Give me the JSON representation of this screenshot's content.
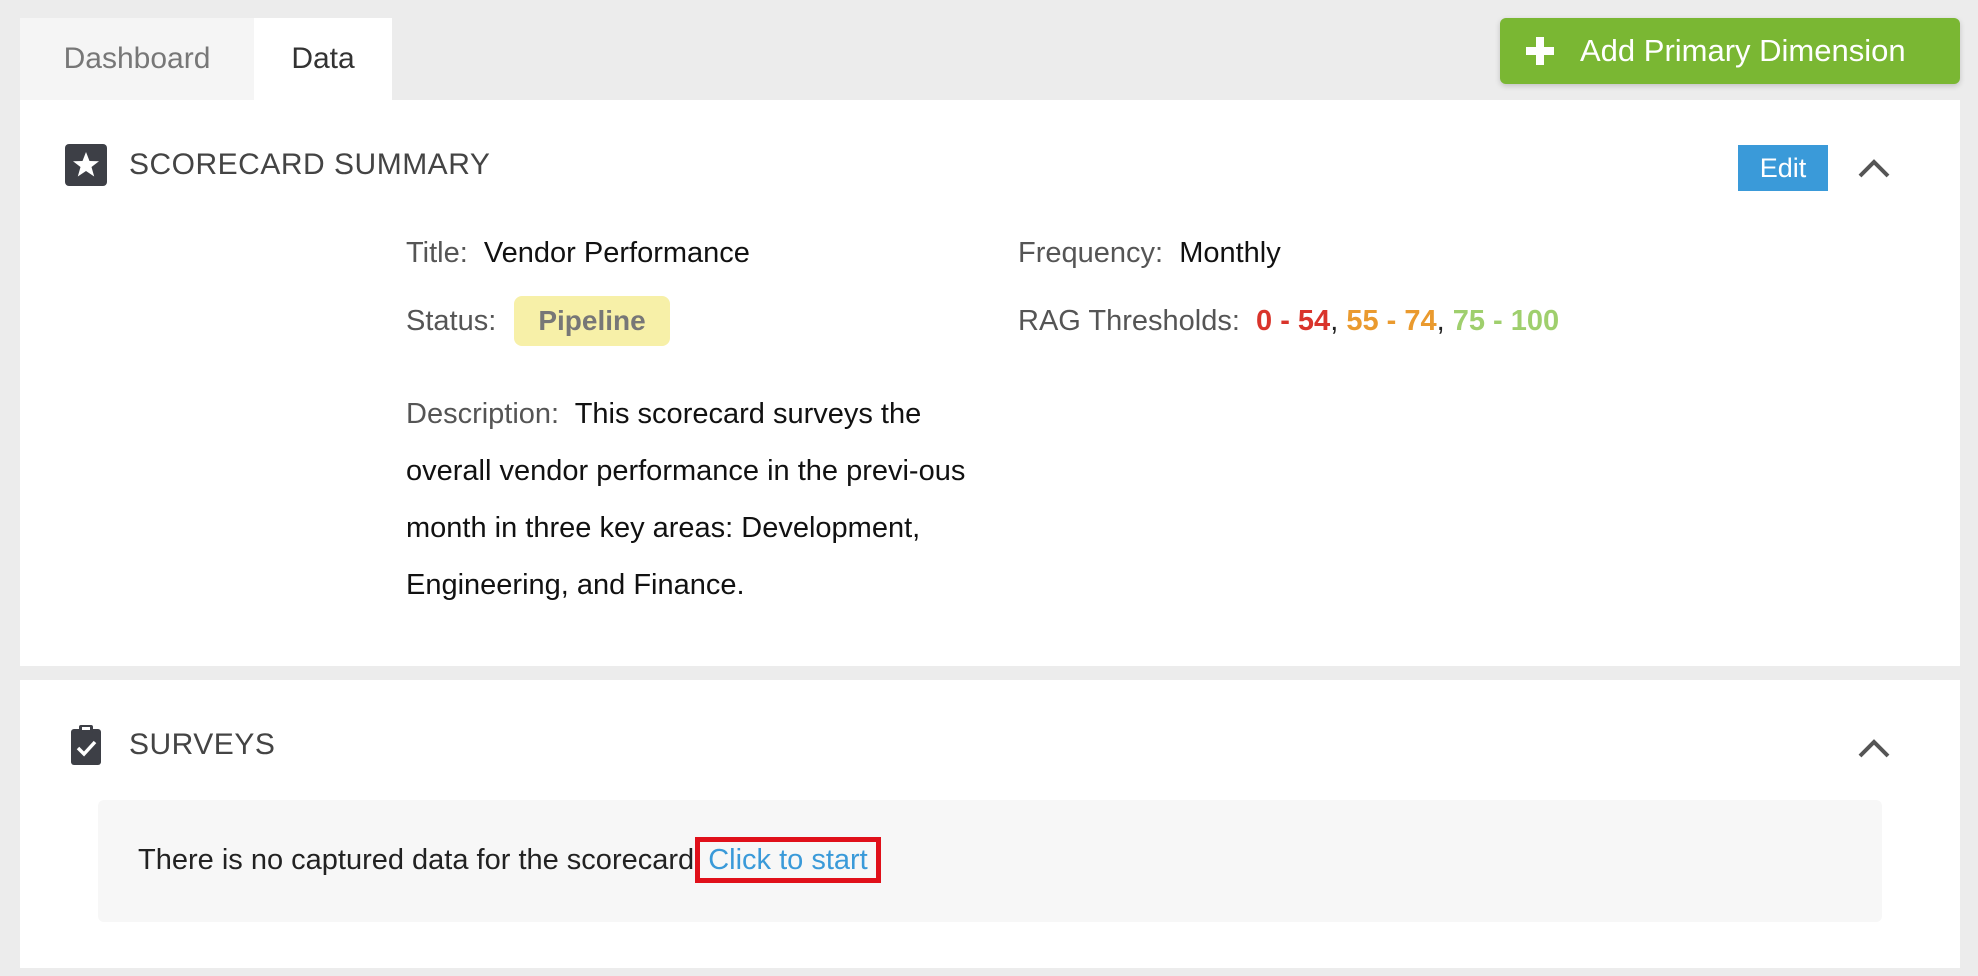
{
  "tabs": [
    {
      "label": "Dashboard",
      "active": false
    },
    {
      "label": "Data",
      "active": true
    }
  ],
  "add_button": {
    "label": "Add Primary Dimension",
    "icon": "plus-icon",
    "color": "#7ab733"
  },
  "summary": {
    "title": "SCORECARD SUMMARY",
    "icon": "star-icon",
    "edit_label": "Edit",
    "fields": {
      "title_label": "Title:",
      "title_value": "Vendor Performance",
      "status_label": "Status:",
      "status_value": "Pipeline",
      "frequency_label": "Frequency:",
      "frequency_value": "Monthly",
      "rag_label": "RAG Thresholds:",
      "rag_red": "0 - 54",
      "rag_orange": "55 - 74",
      "rag_green": "75 - 100",
      "description_label": "Description:",
      "description_value": "This scorecard surveys the overall vendor performance in the previ-ous month in three key areas: Development, Engineering, and Finance."
    }
  },
  "surveys": {
    "title": "SURVEYS",
    "icon": "clipboard-check-icon",
    "empty_message": "There is no captured data for the scorecard.",
    "start_link": "Click to start"
  },
  "colors": {
    "accent_blue": "#3a9ad9",
    "rag_red": "#d9342b",
    "rag_orange": "#ea9a2e",
    "rag_green": "#9fcf6d",
    "status_pipeline_bg": "#f7f0a8"
  }
}
